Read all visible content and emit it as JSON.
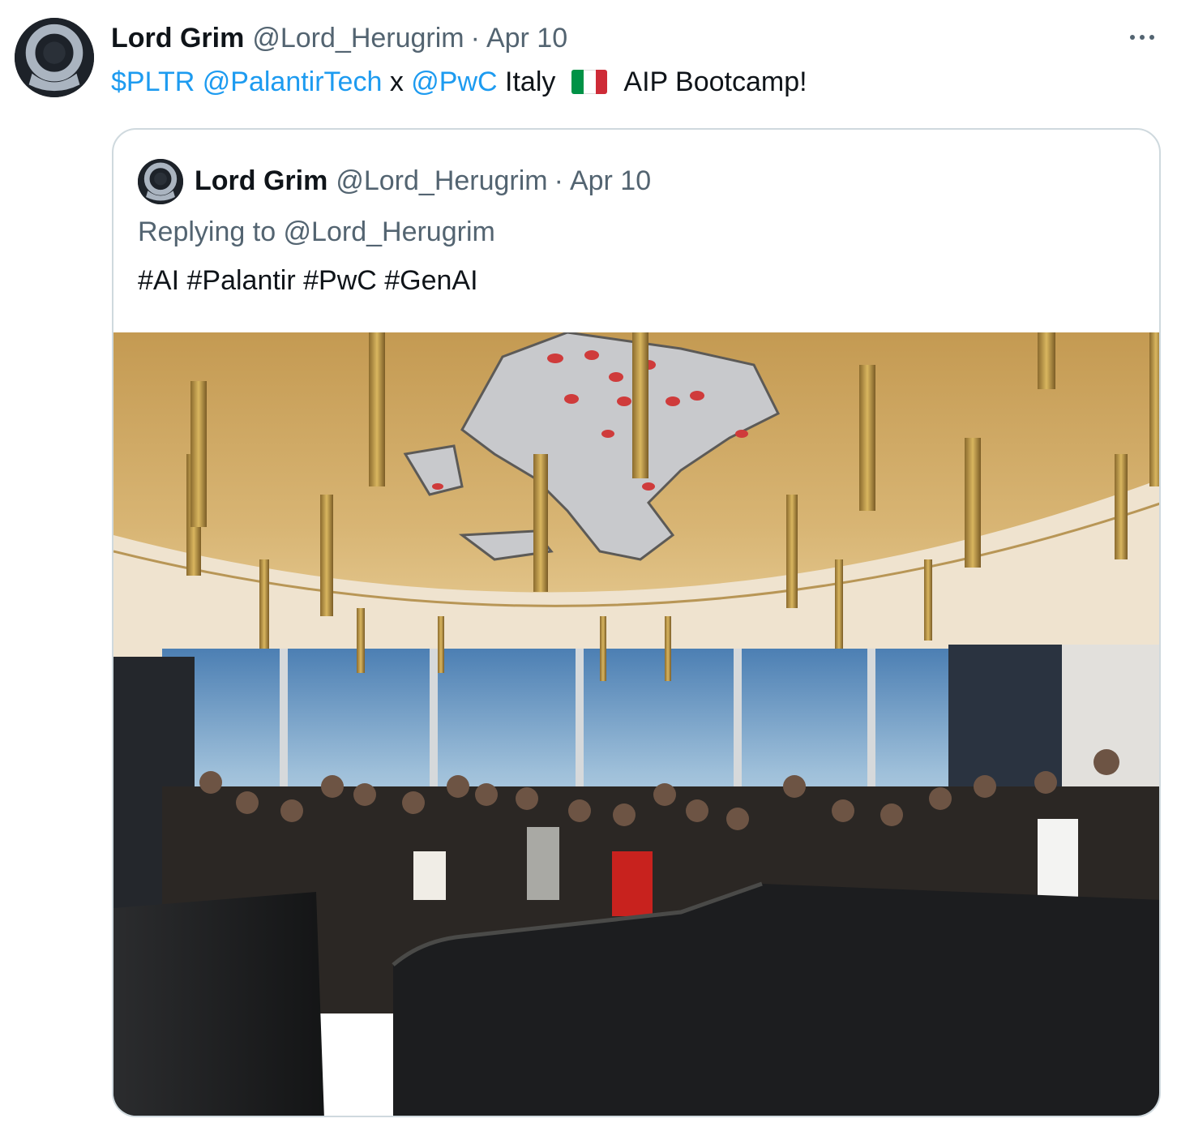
{
  "tweet": {
    "author_name": "Lord Grim",
    "author_handle": "@Lord_Herugrim",
    "separator": "·",
    "date": "Apr 10",
    "text": {
      "ticker": "$PLTR",
      "mention1": "@PalantirTech",
      "x": " x ",
      "mention2": "@PwC",
      "country": " Italy",
      "tail": "AIP Bootcamp!"
    },
    "flag_colors": [
      "#009246",
      "#ffffff",
      "#ce2b37"
    ]
  },
  "quoted": {
    "author_name": "Lord Grim",
    "author_handle": "@Lord_Herugrim",
    "separator": "·",
    "date": "Apr 10",
    "replying_to": "Replying to @Lord_Herugrim",
    "hashtags": "#AI #Palantir #PwC #GenAI"
  },
  "colors": {
    "link": "#1d9bf0",
    "secondary_text": "#536471",
    "border": "#cfd9de"
  },
  "icons": {
    "more": "more-horizontal-icon",
    "avatar": "avatar-ring-icon"
  }
}
